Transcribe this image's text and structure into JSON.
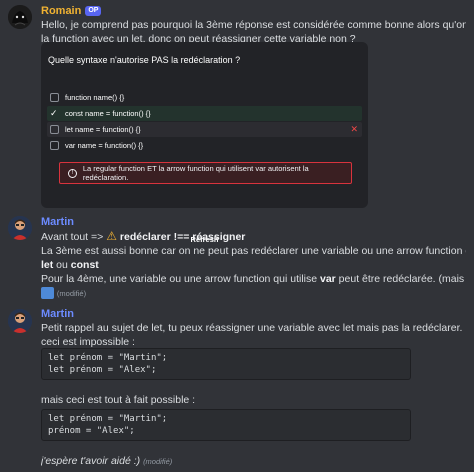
{
  "colors": {
    "background": "#313338",
    "romain_name": "#f0b232",
    "martin_name": "#6c8bff",
    "op_badge": "#5865f2",
    "correct_option": "#23332d",
    "alert_border": "#d9333d"
  },
  "message1": {
    "author": "Romain",
    "badge": "OP",
    "lines": [
      "Hello, je comprend pas pourquoi la 3ème réponse est considérée comme bonne alors qu'on déclare",
      "la function avec un let, donc on peut réassigner cette variable non ?"
    ]
  },
  "quiz": {
    "question": "Quelle syntaxe n'autorise PAS la redéclaration ?",
    "options": [
      {
        "label": "function name() {}",
        "state": "unchecked"
      },
      {
        "label": "const name = function() {}",
        "state": "correct"
      },
      {
        "label": "let name = function() {}",
        "state": "wrong"
      },
      {
        "label": "var name = function() {}",
        "state": "unchecked"
      }
    ],
    "alert": "La regular function ET la arrow function qui utilisent var autorisent la redéclaration.",
    "refresh": "Refresh"
  },
  "message2": {
    "author": "Martin",
    "line1_prefix": "Avant tout =>",
    "line1_bold": "redéclarer !== réassigner",
    "line2": "La 3ème est aussi bonne car on ne peut pas redéclarer une variable ou une arrow function qui utilise",
    "line3_b1": "let",
    "line3_mid": " ou ",
    "line3_b2": "const",
    "line4_pre": "Pour la 4ème,  une variable ou une arrow function qui utilise ",
    "line4_bold": "var",
    "line4_post": " peut être redéclarée. (mais var ===",
    "edited": "(modifié)"
  },
  "message3": {
    "author": "Martin",
    "line1": "Petit rappel au sujet de let, tu peux réassigner une variable avec let mais pas la redéclarer.",
    "line2": "ceci est impossible :",
    "code1": "let prénom = \"Martin\";\nlet prénom = \"Alex\";",
    "line3": "mais ceci est tout à fait possible :",
    "code2": "let prénom = \"Martin\";\nprénom = \"Alex\";",
    "line4": "j'espère t'avoir aidé :)",
    "edited": "(modifié)"
  }
}
